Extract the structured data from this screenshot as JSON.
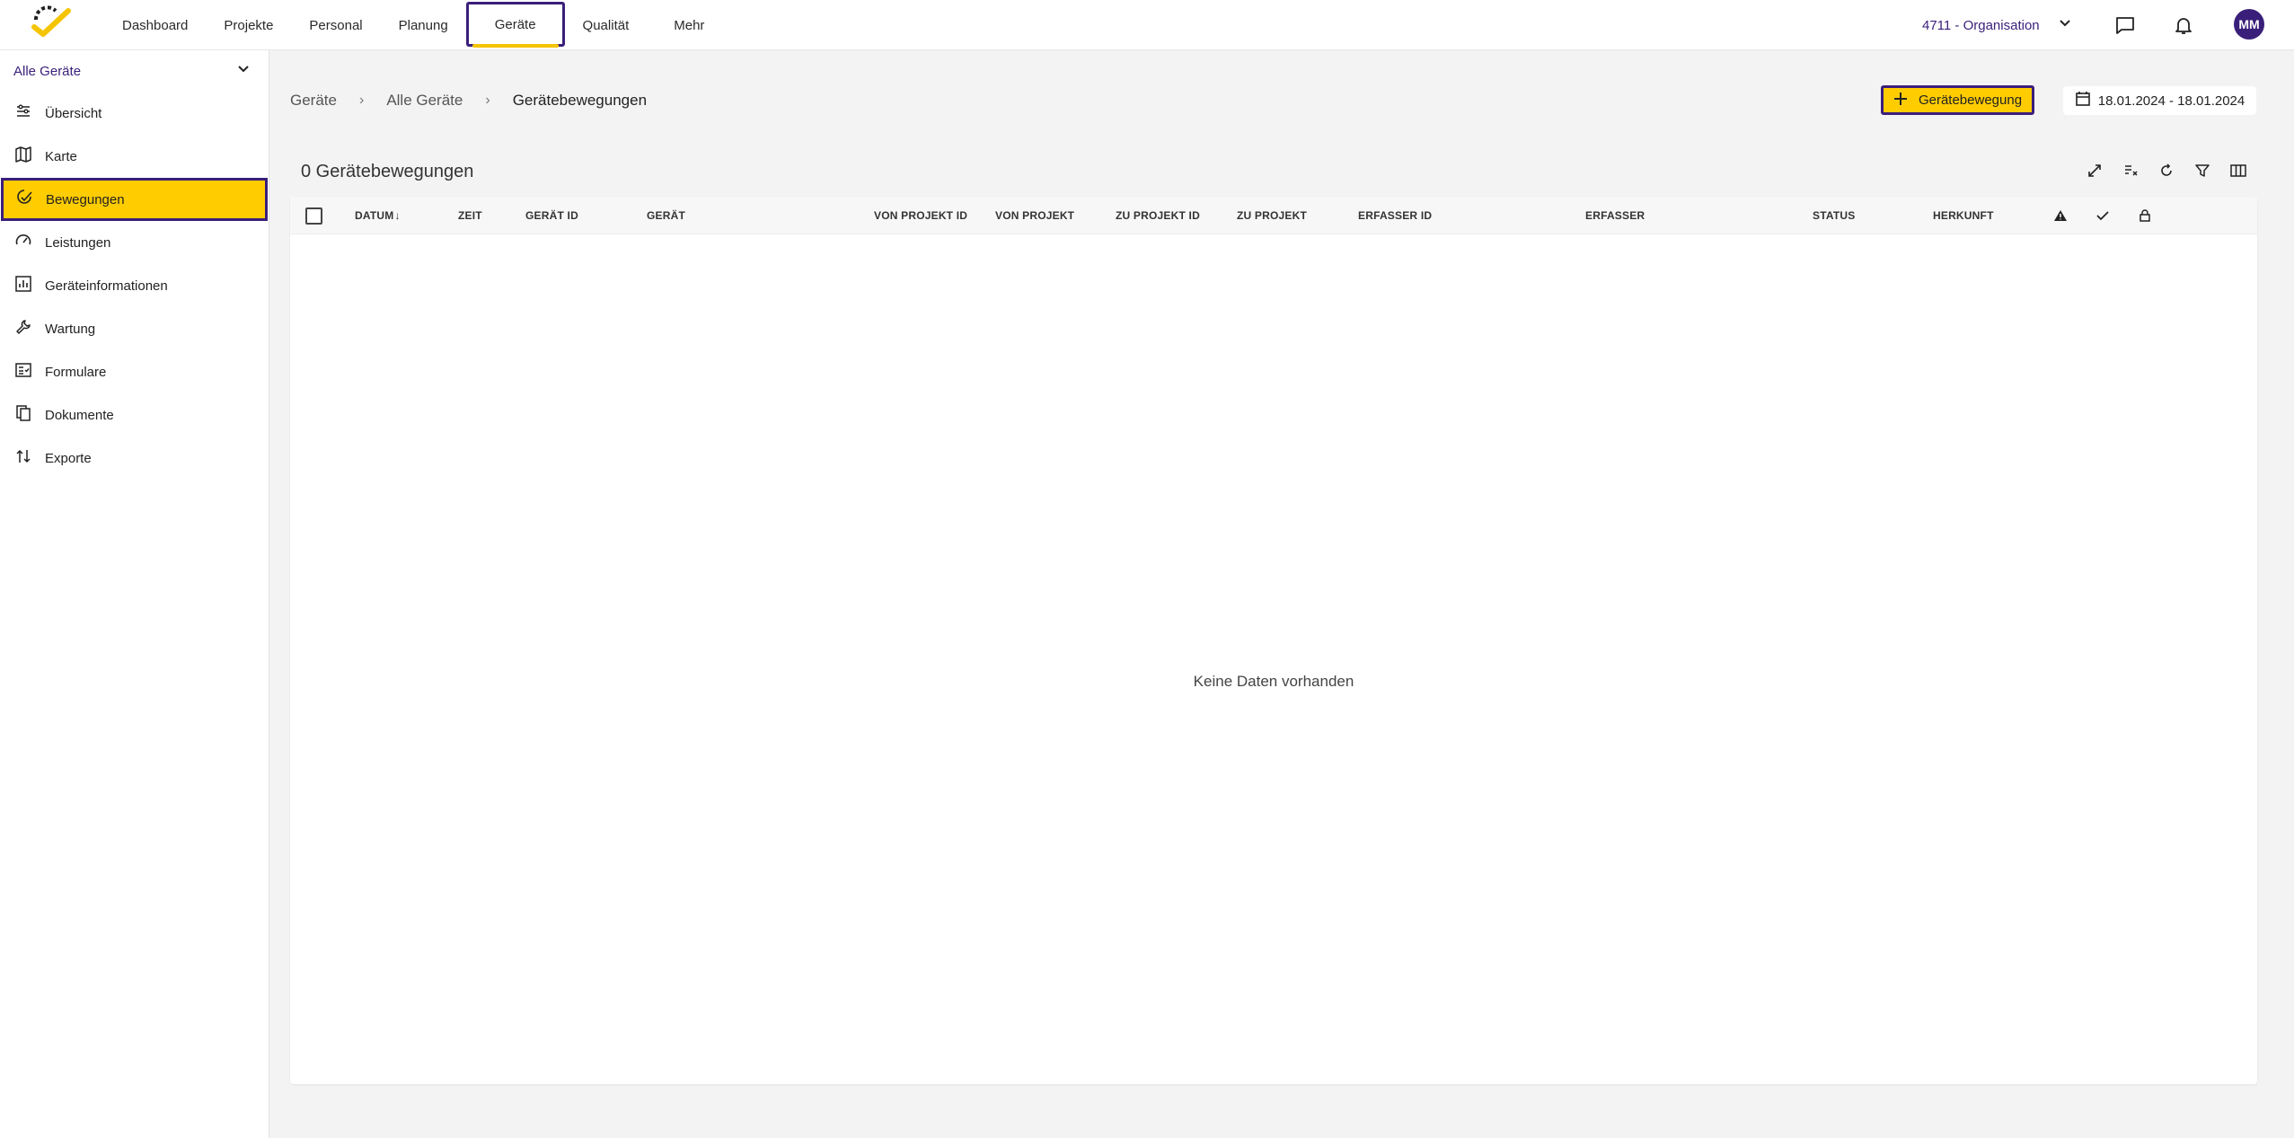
{
  "nav": {
    "items": [
      {
        "label": "Dashboard"
      },
      {
        "label": "Projekte"
      },
      {
        "label": "Personal"
      },
      {
        "label": "Planung"
      },
      {
        "label": "Geräte",
        "active": true
      },
      {
        "label": "Qualität"
      },
      {
        "label": "Mehr"
      }
    ],
    "org_label": "4711 - Organisation",
    "avatar_initials": "MM"
  },
  "sidebar": {
    "section_label": "Alle Geräte",
    "items": [
      {
        "label": "Übersicht",
        "icon": "overview-icon"
      },
      {
        "label": "Karte",
        "icon": "map-icon"
      },
      {
        "label": "Bewegungen",
        "icon": "movement-icon",
        "active": true
      },
      {
        "label": "Leistungen",
        "icon": "gauge-icon"
      },
      {
        "label": "Geräteinformationen",
        "icon": "chart-icon"
      },
      {
        "label": "Wartung",
        "icon": "wrench-icon"
      },
      {
        "label": "Formulare",
        "icon": "form-icon"
      },
      {
        "label": "Dokumente",
        "icon": "documents-icon"
      },
      {
        "label": "Exporte",
        "icon": "export-icon"
      }
    ]
  },
  "breadcrumb": {
    "items": [
      "Geräte",
      "Alle Geräte",
      "Gerätebewegungen"
    ]
  },
  "actions": {
    "add_label": "Gerätebewegung",
    "date_range": "18.01.2024 - 18.01.2024"
  },
  "table": {
    "title": "0 Gerätebewegungen",
    "columns": [
      "DATUM",
      "ZEIT",
      "GERÄT ID",
      "GERÄT",
      "VON PROJEKT ID",
      "VON PROJEKT",
      "ZU PROJEKT ID",
      "ZU PROJEKT",
      "ERFASSER ID",
      "ERFASSER",
      "STATUS",
      "HERKUNFT"
    ],
    "sort_indicator": "↓",
    "empty_text": "Keine Daten vorhanden"
  },
  "colors": {
    "accent": "#ffcc00",
    "brand": "#3a1f7a"
  }
}
